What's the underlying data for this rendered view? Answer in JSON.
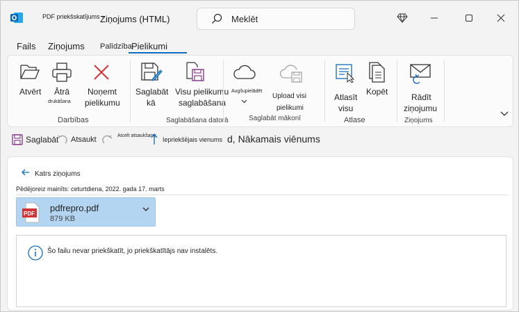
{
  "titlebar": {
    "prefix": "PDF priekšskatījums –",
    "title": "Ziņojums (HTML)",
    "search_placeholder": "Meklēt"
  },
  "tabs": {
    "file": "Fails",
    "message": "Ziņojums",
    "help": "Palīdzība",
    "attachments": "Pielikumi"
  },
  "ribbon": {
    "open": "Atvērt",
    "quick_print_1": "Ātrā",
    "quick_print_2": "drukāšana",
    "remove_1": "Noņemt",
    "remove_2": "pielikumu",
    "group_actions": "Darbības",
    "save_as_1": "Saglabāt",
    "save_as_2": "kā",
    "save_all_1": "Visu pielikumu",
    "save_all_2": "saglabāšana",
    "group_save_pc": "Saglabāšana datorā",
    "upload": "Augšupielādēt",
    "upload_all_1": "Upload visi",
    "upload_all_2": "pielikumi",
    "group_save_cloud": "Saglabāt mākonī",
    "select_all_1": "Atlasīt",
    "select_all_2": "visu",
    "copy": "Kopēt",
    "group_select": "Atlase",
    "show_message_1": "Rādīt",
    "show_message_2": "ziņojumu",
    "group_messages": "Ziņojums"
  },
  "qat": {
    "save": "Saglabāt",
    "undo": "Atsaukt",
    "redo": "Atcelt atsaukšanu",
    "previous": "Iepriekšējais vienums",
    "next": "d, Nākamais viēnums"
  },
  "content": {
    "back": "Katrs ziņojums",
    "modified": "Pēdējoreiz mainīts:  ceturtdiena, 2022. gada 17. marts",
    "attachment_name": "pdfrepro.pdf",
    "attachment_size": "879 KB",
    "pdf_badge": "PDF",
    "preview_message": "Šo failu nevar priekškatīt, jo priekškatītājs nav instalēts."
  },
  "colors": {
    "accent": "#0f6cbd",
    "attachment_bg": "#b3d5f1",
    "pdf_red": "#d13438",
    "save_purple": "#8a3b8f"
  }
}
